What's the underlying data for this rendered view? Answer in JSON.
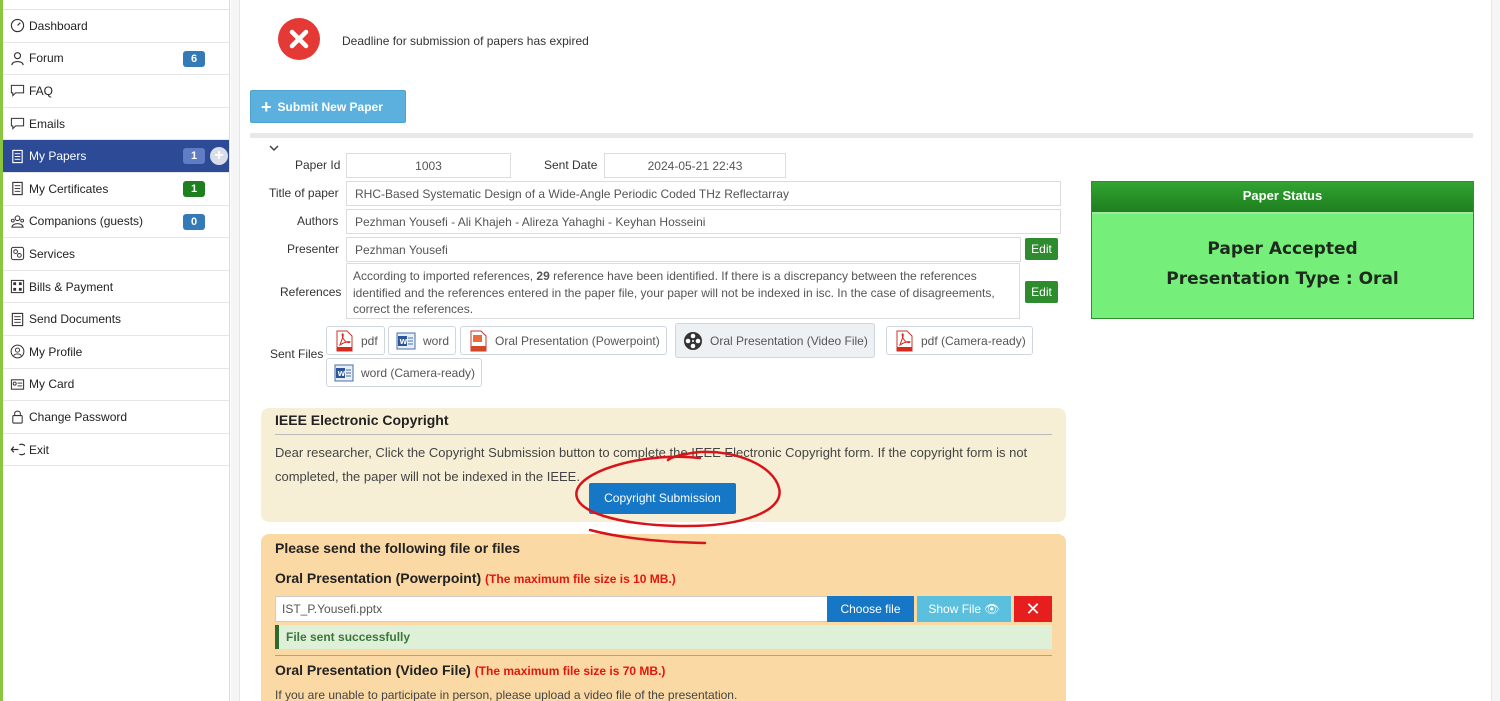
{
  "sidebar": {
    "items": [
      {
        "label": "Dashboard",
        "icon": "dashboard-icon"
      },
      {
        "label": "Forum",
        "icon": "user-icon",
        "badge": "6"
      },
      {
        "label": "FAQ",
        "icon": "chat-icon"
      },
      {
        "label": "Emails",
        "icon": "chat-icon"
      },
      {
        "label": "My Papers",
        "icon": "document-icon",
        "badge": "1"
      },
      {
        "label": "My Certificates",
        "icon": "document-icon",
        "badge": "1"
      },
      {
        "label": "Companions (guests)",
        "icon": "guests-icon",
        "badge": "0"
      },
      {
        "label": "Services",
        "icon": "services-icon"
      },
      {
        "label": "Bills & Payment",
        "icon": "bills-icon"
      },
      {
        "label": "Send Documents",
        "icon": "document-icon"
      },
      {
        "label": "My Profile",
        "icon": "profile-icon"
      },
      {
        "label": "My Card",
        "icon": "card-icon"
      },
      {
        "label": "Change Password",
        "icon": "lock-icon"
      },
      {
        "label": "Exit",
        "icon": "exit-icon"
      }
    ]
  },
  "notice": {
    "message": "Deadline for submission of papers has expired"
  },
  "toolbar": {
    "submit_label": "Submit New Paper"
  },
  "paper": {
    "paper_id_label": "Paper Id",
    "paper_id": "1003",
    "sent_date_label": "Sent Date",
    "sent_date": "2024-05-21 22:43",
    "title_label": "Title of paper",
    "title": "RHC-Based Systematic Design of a Wide-Angle Periodic Coded THz Reflectarray",
    "authors_label": "Authors",
    "authors": "Pezhman Yousefi - Ali Khajeh - Alireza Yahaghi - Keyhan Hosseini",
    "presenter_label": "Presenter",
    "presenter": "Pezhman Yousefi",
    "edit_label": "Edit",
    "references_label": "References",
    "references_pre": "According to imported references, ",
    "references_count": "29",
    "references_post": " reference have been identified. If there is a discrepancy between the references identified and the references entered in the paper file, your paper will not be indexed in isc. In the case of disagreements, correct the references.",
    "sent_files_label": "Sent Files",
    "files": [
      {
        "label": "pdf",
        "icon": "pdf-icon"
      },
      {
        "label": "word",
        "icon": "word-icon"
      },
      {
        "label": "Oral Presentation (Powerpoint)",
        "icon": "powerpoint-icon"
      },
      {
        "label": "Oral Presentation (Video File)",
        "icon": "film-reel-icon"
      },
      {
        "label": "pdf (Camera-ready)",
        "icon": "pdf-icon"
      },
      {
        "label": "word (Camera-ready)",
        "icon": "word-icon"
      }
    ]
  },
  "status": {
    "title": "Paper Status",
    "line1": "Paper Accepted",
    "line2": "Presentation Type : Oral"
  },
  "copyright": {
    "title": "IEEE Electronic Copyright",
    "text": "Dear researcher, Click the Copyright Submission button to complete the IEEE Electronic Copyright form. If the copyright form is not completed, the paper will not be indexed in the IEEE.",
    "button": "Copyright Submission"
  },
  "upload": {
    "heading": "Please send the following file or files",
    "ppt_title": "Oral Presentation (Powerpoint)",
    "ppt_note": "(The maximum file size is 10 MB.)",
    "ppt_file": "IST_P.Yousefi.pptx",
    "choose_label": "Choose file",
    "show_label": "Show File",
    "success_msg": "File sent successfully",
    "video_title": "Oral Presentation (Video File)",
    "video_note": "(The maximum file size is 70 MB.)",
    "video_hint": "If you are unable to participate in person, please upload a video file of the presentation."
  },
  "colors": {
    "sidebar_active": "#2c4a96",
    "status_green": "#76ee7a",
    "copyright_bg": "#f6efd6",
    "upload_bg": "#fbd9a4",
    "annotation_red": "#d8141b"
  }
}
